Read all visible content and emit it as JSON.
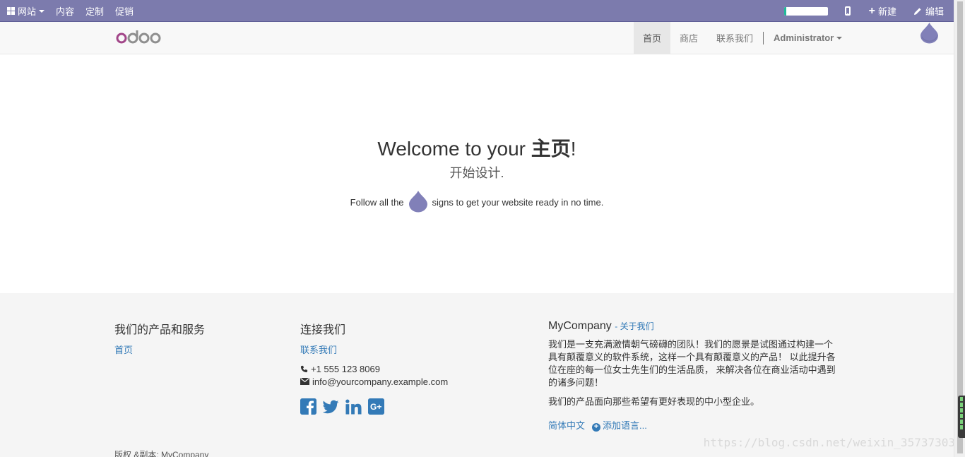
{
  "adminbar": {
    "menu": [
      {
        "label": "网站",
        "icon": "apps-grid-icon",
        "dropdown": true
      },
      {
        "label": "内容"
      },
      {
        "label": "定制"
      },
      {
        "label": "促销"
      }
    ],
    "progress_fraction": 0.05,
    "new_label": "新建",
    "edit_label": "编辑"
  },
  "navbar": {
    "logo_text": "odoo",
    "links": [
      "首页",
      "商店",
      "联系我们"
    ],
    "active_index": 0,
    "user": "Administrator"
  },
  "hero": {
    "title_prefix": "Welcome to your ",
    "title_bold": "主页",
    "title_suffix": "!",
    "subtitle": "开始设计.",
    "follow_prefix": "Follow all the",
    "follow_suffix": "signs to get your website ready in no time."
  },
  "footer": {
    "products": {
      "heading": "我们的产品和服务",
      "links": [
        "首页"
      ]
    },
    "connect": {
      "heading": "连接我们",
      "link": "联系我们",
      "phone": "+1 555 123 8069",
      "email": "info@yourcompany.example.com",
      "social": [
        "facebook-icon",
        "twitter-icon",
        "linkedin-icon",
        "google-plus-icon"
      ]
    },
    "about": {
      "company": "MyCompany",
      "about_link": "- 关于我们",
      "paragraph1": "我们是一支充满激情朝气磅礴的团队！我们的愿景是试图通过构建一个具有颠覆意义的软件系统，这样一个具有颠覆意义的产品！ 以此提升各位在座的每一位女士先生们的生活品质， 来解决各位在商业活动中遇到的诸多问题！",
      "paragraph2": "我们的产品面向那些希望有更好表现的中小型企业。",
      "language": "简体中文",
      "add_language": "添加语言..."
    },
    "copyright": "版权 &副本: MyCompany"
  },
  "watermark": "https://blog.csdn.net/weixin_35737303",
  "colors": {
    "adminbar": "#7c7bad",
    "link": "#337ab7",
    "drop": "#8180b8"
  }
}
